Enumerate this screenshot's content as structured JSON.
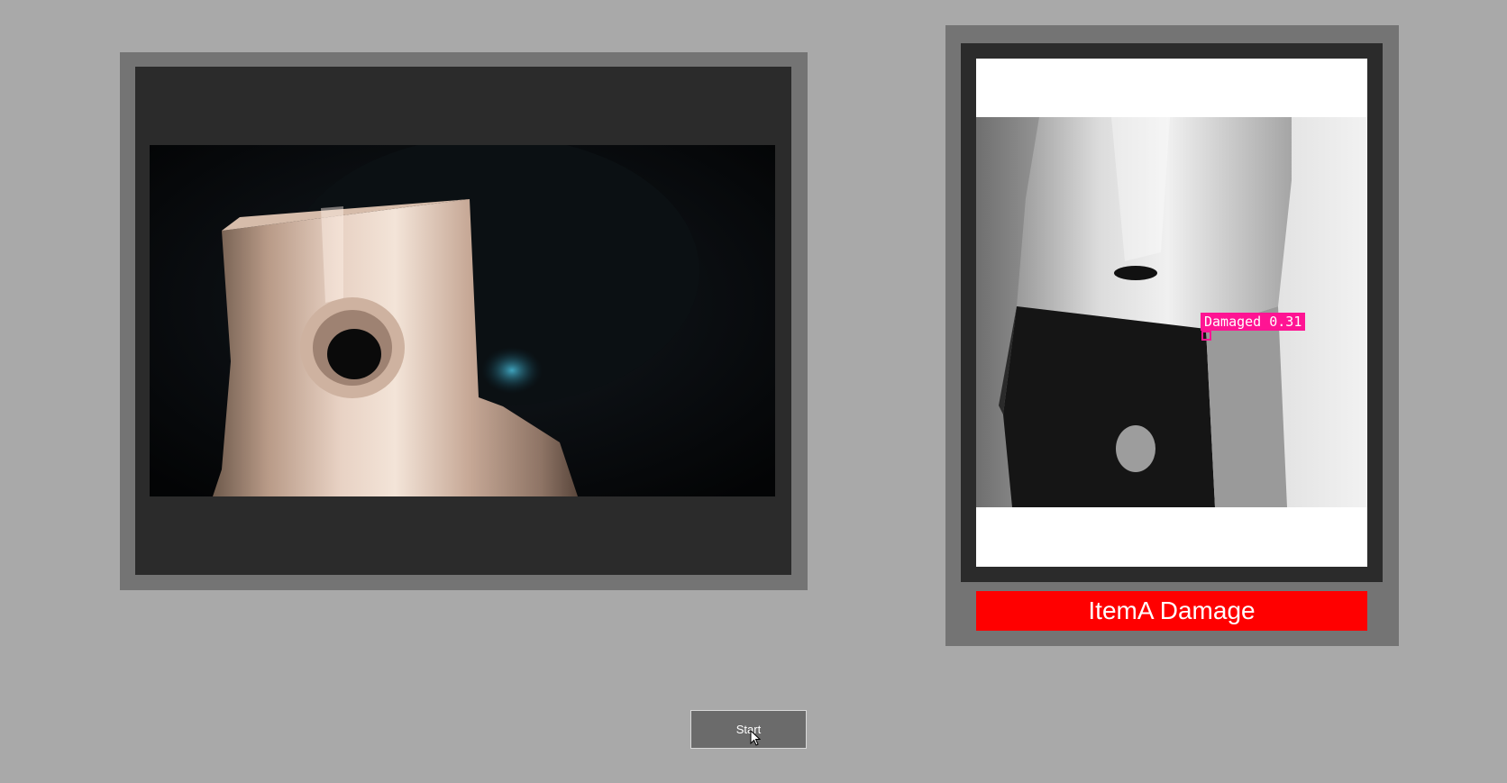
{
  "camera_panel": {
    "feed_description": "live-camera-feed"
  },
  "result_panel": {
    "detection": {
      "label": "Damaged 0.31",
      "color": "#ff1493"
    },
    "status": {
      "text": "ItemA Damage",
      "color": "#ff0000"
    }
  },
  "controls": {
    "start_label": "Start"
  },
  "colors": {
    "background": "#a9a9a9",
    "panel_frame": "#747474",
    "panel_inner": "#2b2b2b"
  }
}
